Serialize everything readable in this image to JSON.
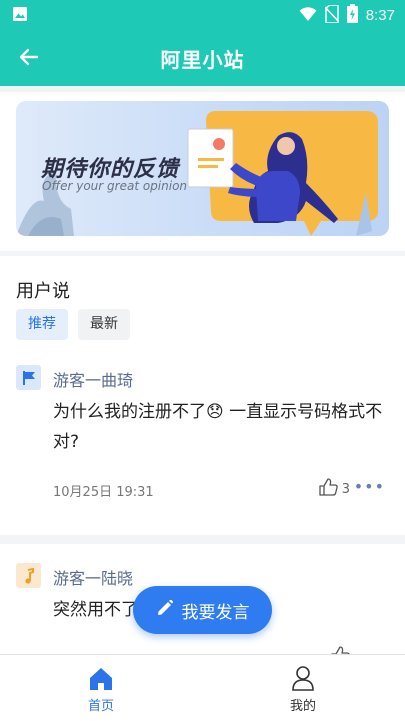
{
  "status_bar": {
    "time": "8:37"
  },
  "app_bar": {
    "title": "阿里小站",
    "back_icon": "arrow-left-icon"
  },
  "banner": {
    "title": "期待你的反馈",
    "subtitle": "Offer your great opinion"
  },
  "section": {
    "title": "用户说",
    "tabs": [
      {
        "label": "推荐",
        "active": true
      },
      {
        "label": "最新",
        "active": false
      }
    ]
  },
  "posts": [
    {
      "avatar_icon": "flag-icon",
      "avatar_color": "#2b73e8",
      "author": "游客一曲琦",
      "content": "为什么我的注册不了😞 一直显示号码格式不对?",
      "time": "10月25日 19:31",
      "likes": "3"
    },
    {
      "avatar_icon": "music-note-icon",
      "avatar_color": "#f0a02a",
      "author": "游客一陆晓",
      "content": "突然用不了",
      "time": "",
      "likes": ""
    }
  ],
  "fab": {
    "label": "我要发言",
    "icon": "pencil-icon"
  },
  "bottom_nav": {
    "items": [
      {
        "label": "首页",
        "icon": "home-icon",
        "active": true,
        "color": "#2b73e8"
      },
      {
        "label": "我的",
        "icon": "user-icon",
        "active": false,
        "color": "#333333"
      }
    ]
  },
  "colors": {
    "primary": "#1ec9b6",
    "accent": "#2f7bf0"
  }
}
